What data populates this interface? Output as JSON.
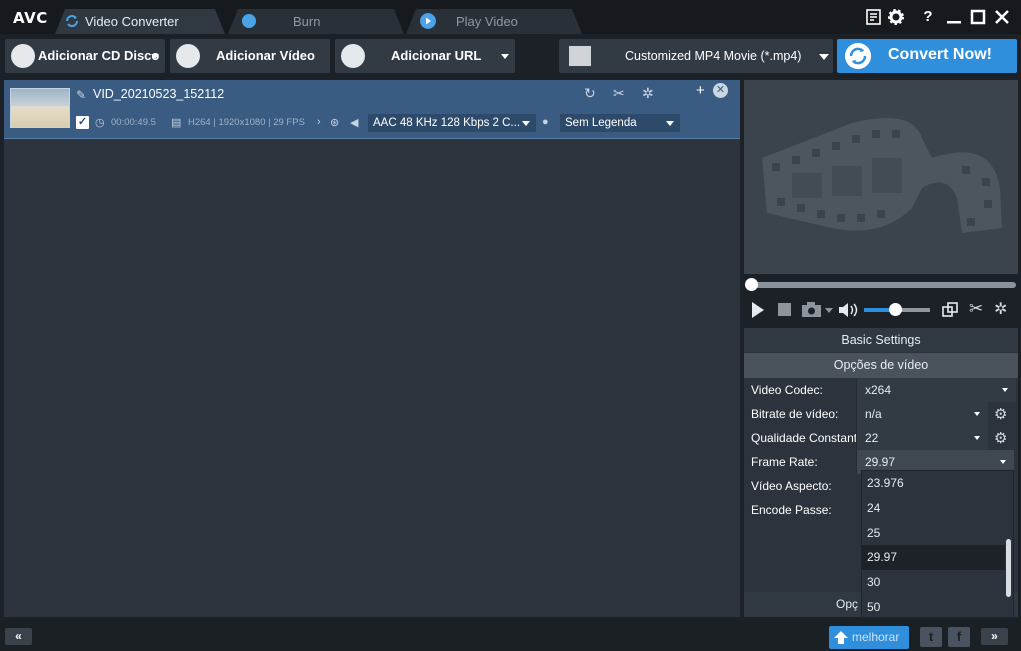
{
  "app": {
    "logo": "AVC"
  },
  "tabs": [
    {
      "label": "Video Converter",
      "active": true
    },
    {
      "label": "Burn",
      "active": false
    },
    {
      "label": "Play Video",
      "active": false
    }
  ],
  "window_controls": {
    "help": "?"
  },
  "toolbar": {
    "add_cd_label": "Adicionar CD Disco",
    "add_video_label": "Adicionar Vídeo",
    "add_url_label": "Adicionar URL",
    "format_label": "Customized MP4 Movie (*.mp4)",
    "convert_label": "Convert Now!"
  },
  "file": {
    "name": "VID_20210523_152112",
    "duration": "00:00:49.5",
    "video_info": "H264 | 1920x1080 | 29 FPS",
    "audio_track": "AAC 48 KHz 128 Kbps 2 C...",
    "subtitle": "Sem Legenda",
    "checked": true
  },
  "settings": {
    "basic_header": "Basic Settings",
    "video_header": "Opções de vídeo",
    "rows": [
      {
        "label": "Video Codec:",
        "value": "x264"
      },
      {
        "label": "Bitrate de vídeo:",
        "value": "n/a"
      },
      {
        "label": "Qualidade Constant",
        "value": "22"
      },
      {
        "label": "Frame Rate:",
        "value": "29.97"
      },
      {
        "label": "Vídeo Aspecto:",
        "value": ""
      },
      {
        "label": "Encode Passe:",
        "value": ""
      }
    ],
    "footer_label": "Opç"
  },
  "framerate_options": [
    "23.976",
    "24",
    "25",
    "29.97",
    "30",
    "50"
  ],
  "framerate_selected": "29.97",
  "bottom": {
    "collapse": "«",
    "upgrade_label": "melhorar",
    "twitter": "t",
    "facebook": "f",
    "expand": "»"
  },
  "colors": {
    "accent": "#2f8fdc",
    "selected_row": "#3a5b82"
  }
}
